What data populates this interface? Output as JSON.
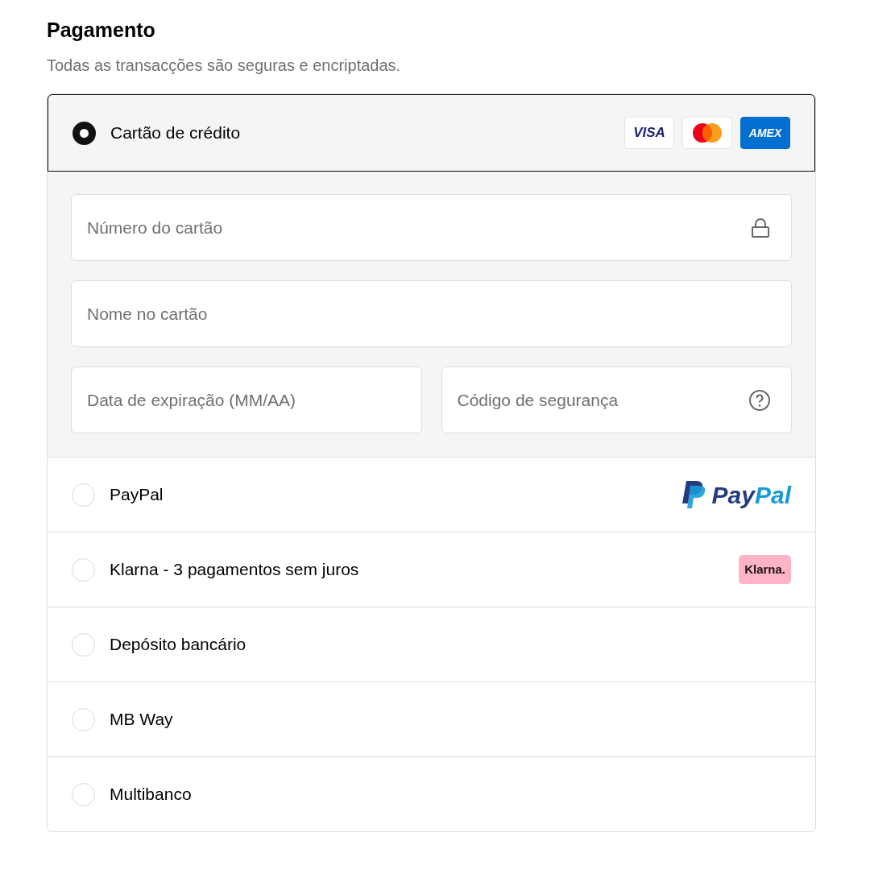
{
  "title": "Pagamento",
  "subtitle": "Todas as transacções são seguras e encriptadas.",
  "methods": [
    {
      "label": "Cartão de crédito",
      "selected": true,
      "logos": [
        {
          "kind": "visa",
          "text": "VISA"
        },
        {
          "kind": "mastercard"
        },
        {
          "kind": "amex",
          "text": "AMEX"
        }
      ],
      "fields": [
        {
          "kind": "lock",
          "placeholder": "Número do cartão"
        },
        {
          "kind": "plain",
          "placeholder": "Nome no cartão"
        },
        {
          "kind": "half",
          "placeholder": "Data de expiração (MM/AA)"
        },
        {
          "kind": "help",
          "placeholder": "Código de segurança"
        }
      ]
    },
    {
      "label": "PayPal",
      "selected": false,
      "logos": [
        {
          "kind": "paypal",
          "text_parts": [
            "Pay",
            "Pal"
          ]
        }
      ]
    },
    {
      "label": "Klarna - 3 pagamentos sem juros",
      "selected": false,
      "logos": [
        {
          "kind": "klarna",
          "text": "Klarna."
        }
      ]
    },
    {
      "label": "Depósito bancário",
      "selected": false
    },
    {
      "label": "MB Way",
      "selected": false
    },
    {
      "label": "Multibanco",
      "selected": false
    }
  ]
}
